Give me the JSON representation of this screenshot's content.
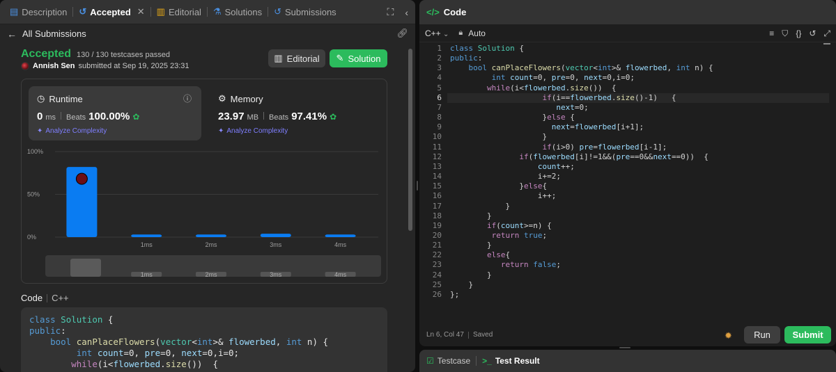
{
  "left_tabs": [
    {
      "label": "Description",
      "icon": "description-icon"
    },
    {
      "label": "Accepted",
      "icon": "history-icon",
      "active": true
    },
    {
      "label": "Editorial",
      "icon": "book-icon"
    },
    {
      "label": "Solutions",
      "icon": "flask-icon"
    },
    {
      "label": "Submissions",
      "icon": "history-icon"
    }
  ],
  "subheader": {
    "back_label": "All Submissions"
  },
  "submission": {
    "status": "Accepted",
    "testcases": "130 / 130 testcases passed",
    "user": "Annish Sen",
    "submitted_at": "submitted at Sep 19, 2025 23:31",
    "editorial_button": "Editorial",
    "solution_button": "Solution"
  },
  "runtime": {
    "title": "Runtime",
    "value": "0",
    "unit": "ms",
    "beats_label": "Beats",
    "beats": "100.00%",
    "analyze": "Analyze Complexity"
  },
  "memory": {
    "title": "Memory",
    "value": "23.97",
    "unit": "MB",
    "beats_label": "Beats",
    "beats": "97.41%",
    "analyze": "Analyze Complexity"
  },
  "chart_data": {
    "type": "bar",
    "categories": [
      "0ms",
      "1ms",
      "2ms",
      "3ms",
      "4ms"
    ],
    "tick_labels": [
      "",
      "1ms",
      "2ms",
      "3ms",
      "4ms"
    ],
    "values": [
      82,
      3,
      3,
      4,
      3
    ],
    "yticks": [
      "100%",
      "50%",
      "0%"
    ],
    "ylim": [
      0,
      100
    ],
    "highlight_index": 0,
    "color": "#0a7cf2",
    "navigator_ticks": [
      "1ms",
      "2ms",
      "3ms",
      "4ms"
    ]
  },
  "code_section": {
    "label": "Code",
    "language": "C++",
    "preview": [
      "class Solution {",
      "public:",
      "    bool canPlaceFlowers(vector<int>& flowerbed, int n) {",
      "         int count=0, pre=0, next=0,i=0;",
      "        while(i<flowerbed.size())  {"
    ]
  },
  "editor": {
    "title": "Code",
    "language": "C++",
    "mode": "Auto",
    "status_position": "Ln 6, Col 47",
    "status_saved": "Saved",
    "run_label": "Run",
    "submit_label": "Submit",
    "current_line": 6,
    "lines": [
      "class Solution {",
      "public:",
      "    bool canPlaceFlowers(vector<int>& flowerbed, int n) {",
      "         int count=0, pre=0, next=0,i=0;",
      "        while(i<flowerbed.size())  {",
      "                    if(i==flowerbed.size()-1)   {",
      "                       next=0;",
      "                    }else {",
      "                      next=flowerbed[i+1];",
      "                    }",
      "                    if(i>0) pre=flowerbed[i-1];",
      "               if(flowerbed[i]!=1&&(pre==0&&next==0))  {",
      "                   count++;",
      "                   i+=2;",
      "               }else{",
      "                   i++;",
      "            }",
      "        }",
      "        if(count>=n) {",
      "         return true;",
      "        }",
      "        else{",
      "           return false;",
      "        }",
      "    }",
      "};"
    ]
  },
  "bottom_tabs": [
    {
      "label": "Testcase",
      "icon": "checkbox-icon"
    },
    {
      "label": "Test Result",
      "icon": "terminal-icon",
      "active": true
    }
  ],
  "colors": {
    "accent_green": "#2cbb5d",
    "bar_blue": "#0a7cf2",
    "analyze_purple": "#7f7fff"
  }
}
